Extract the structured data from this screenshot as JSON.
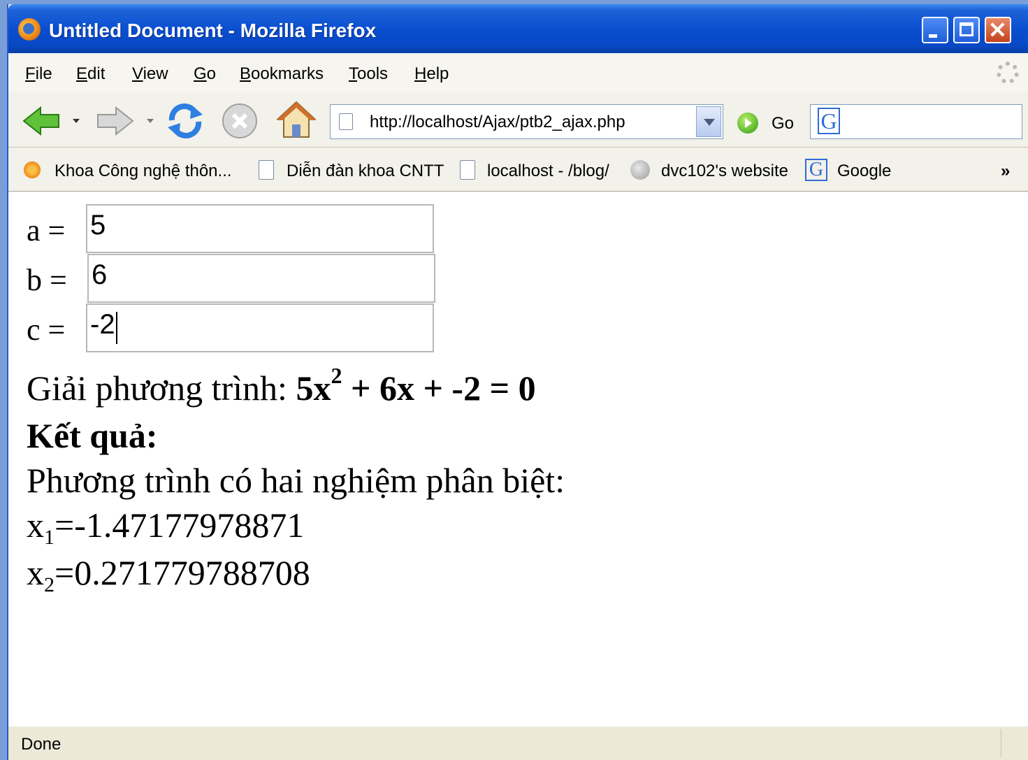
{
  "window": {
    "title": "Untitled Document - Mozilla Firefox"
  },
  "menu": [
    "File",
    "Edit",
    "View",
    "Go",
    "Bookmarks",
    "Tools",
    "Help"
  ],
  "menu_underline": [
    "F",
    "E",
    "V",
    "G",
    "B",
    "T",
    "H"
  ],
  "toolbar": {
    "url": "http://localhost/Ajax/ptb2_ajax.php",
    "go_label": "Go",
    "search_value": ""
  },
  "bookmarks": [
    {
      "label": "Khoa Công nghệ thôn...",
      "icon": "flower-icon"
    },
    {
      "label": "Diễn đàn khoa CNTT",
      "icon": "page-icon"
    },
    {
      "label": "localhost - /blog/",
      "icon": "page-icon"
    },
    {
      "label": "dvc102's website",
      "icon": "globe-icon"
    },
    {
      "label": "Google",
      "icon": "google-icon"
    }
  ],
  "bookmarks_more": "»",
  "form": {
    "a_label": "a =",
    "a_value": "5",
    "b_label": "b =",
    "b_value": "6",
    "c_label": "c =",
    "c_value": "-2"
  },
  "result": {
    "equation_prefix": "Giải phương trình: ",
    "eq_part1": "5x",
    "eq_exp": "2",
    "eq_part2": " + 6x + -2 = 0",
    "heading": "Kết quả:",
    "message": "Phương trình có hai nghiệm phân biệt:",
    "x1_var": "x",
    "x1_sub": "1",
    "x1_value": "=-1.47177978871",
    "x2_var": "x",
    "x2_sub": "2",
    "x2_value": "=0.271779788708"
  },
  "status": {
    "text": "Done"
  },
  "colors": {
    "titlebar": "#0a4fd0",
    "chrome": "#ece9d8",
    "page": "#ffffff"
  }
}
